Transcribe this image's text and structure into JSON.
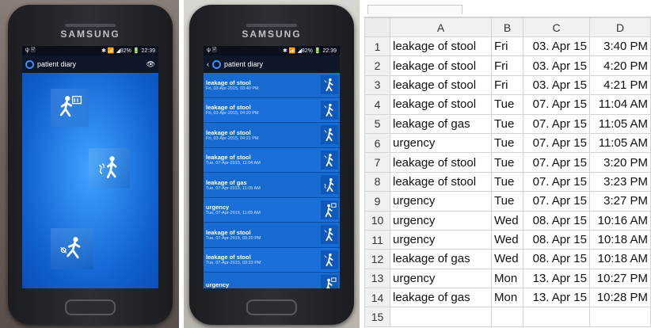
{
  "phone1": {
    "brand": "SAMSUNG",
    "status": {
      "left": "ψ 🖹",
      "right": "✱ 📶 ◢82% 🔋 22:39"
    },
    "app_title": "patient diary",
    "icons": [
      "stool-icon",
      "gas-icon",
      "urgency-icon"
    ]
  },
  "phone2": {
    "brand": "SAMSUNG",
    "status": {
      "left": "ψ 🖹",
      "right": "✱ 📶 ◢82% 🔋 22:39"
    },
    "app_title": "patient diary",
    "entries": [
      {
        "title": "leakage of stool",
        "date": "Fri, 03-Apr-2015, 03:40 PM",
        "icon": "stool-icon"
      },
      {
        "title": "leakage of stool",
        "date": "Fri, 03-Apr-2015, 04:20 PM",
        "icon": "stool-icon"
      },
      {
        "title": "leakage of stool",
        "date": "Fri, 03-Apr-2015, 04:21 PM",
        "icon": "stool-icon"
      },
      {
        "title": "leakage of stool",
        "date": "Tue, 07-Apr-2015, 11:04 AM",
        "icon": "stool-icon"
      },
      {
        "title": "leakage of gas",
        "date": "Tue, 07-Apr-2015, 11:05 AM",
        "icon": "gas-icon"
      },
      {
        "title": "urgency",
        "date": "Tue, 07-Apr-2015, 11:05 AM",
        "icon": "urgency-icon"
      },
      {
        "title": "leakage of stool",
        "date": "Tue, 07-Apr-2015, 03:20 PM",
        "icon": "stool-icon"
      },
      {
        "title": "leakage of stool",
        "date": "Tue, 07-Apr-2015, 03:23 PM",
        "icon": "stool-icon"
      },
      {
        "title": "urgency",
        "date": "",
        "icon": "urgency-icon"
      }
    ]
  },
  "sheet": {
    "columns": [
      "A",
      "B",
      "C",
      "D"
    ],
    "rows": [
      {
        "n": "1",
        "a": "leakage of stool",
        "b": "Fri",
        "c": "03. Apr 15",
        "d": "3:40 PM"
      },
      {
        "n": "2",
        "a": "leakage of stool",
        "b": "Fri",
        "c": "03. Apr 15",
        "d": "4:20 PM"
      },
      {
        "n": "3",
        "a": "leakage of stool",
        "b": "Fri",
        "c": "03. Apr 15",
        "d": "4:21 PM"
      },
      {
        "n": "4",
        "a": "leakage of stool",
        "b": "Tue",
        "c": "07. Apr 15",
        "d": "11:04 AM"
      },
      {
        "n": "5",
        "a": "leakage of gas",
        "b": "Tue",
        "c": "07. Apr 15",
        "d": "11:05 AM"
      },
      {
        "n": "6",
        "a": "urgency",
        "b": "Tue",
        "c": "07. Apr 15",
        "d": "11:05 AM"
      },
      {
        "n": "7",
        "a": "leakage of stool",
        "b": "Tue",
        "c": "07. Apr 15",
        "d": "3:20 PM"
      },
      {
        "n": "8",
        "a": "leakage of stool",
        "b": "Tue",
        "c": "07. Apr 15",
        "d": "3:23 PM"
      },
      {
        "n": "9",
        "a": "urgency",
        "b": "Tue",
        "c": "07. Apr 15",
        "d": "3:27 PM"
      },
      {
        "n": "10",
        "a": "urgency",
        "b": "Wed",
        "c": "08. Apr 15",
        "d": "10:16 AM"
      },
      {
        "n": "11",
        "a": "urgency",
        "b": "Wed",
        "c": "08. Apr 15",
        "d": "10:18 AM"
      },
      {
        "n": "12",
        "a": "leakage of gas",
        "b": "Wed",
        "c": "08. Apr 15",
        "d": "10:18 AM"
      },
      {
        "n": "13",
        "a": "urgency",
        "b": "Mon",
        "c": "13. Apr 15",
        "d": "10:27 PM"
      },
      {
        "n": "14",
        "a": "leakage of gas",
        "b": "Mon",
        "c": "13. Apr 15",
        "d": "10:28 PM"
      },
      {
        "n": "15",
        "a": "",
        "b": "",
        "c": "",
        "d": ""
      }
    ]
  },
  "colors": {
    "screen_blue": "#1b72d6",
    "appbar": "#0d1728",
    "grid": "#d4d4d4"
  }
}
